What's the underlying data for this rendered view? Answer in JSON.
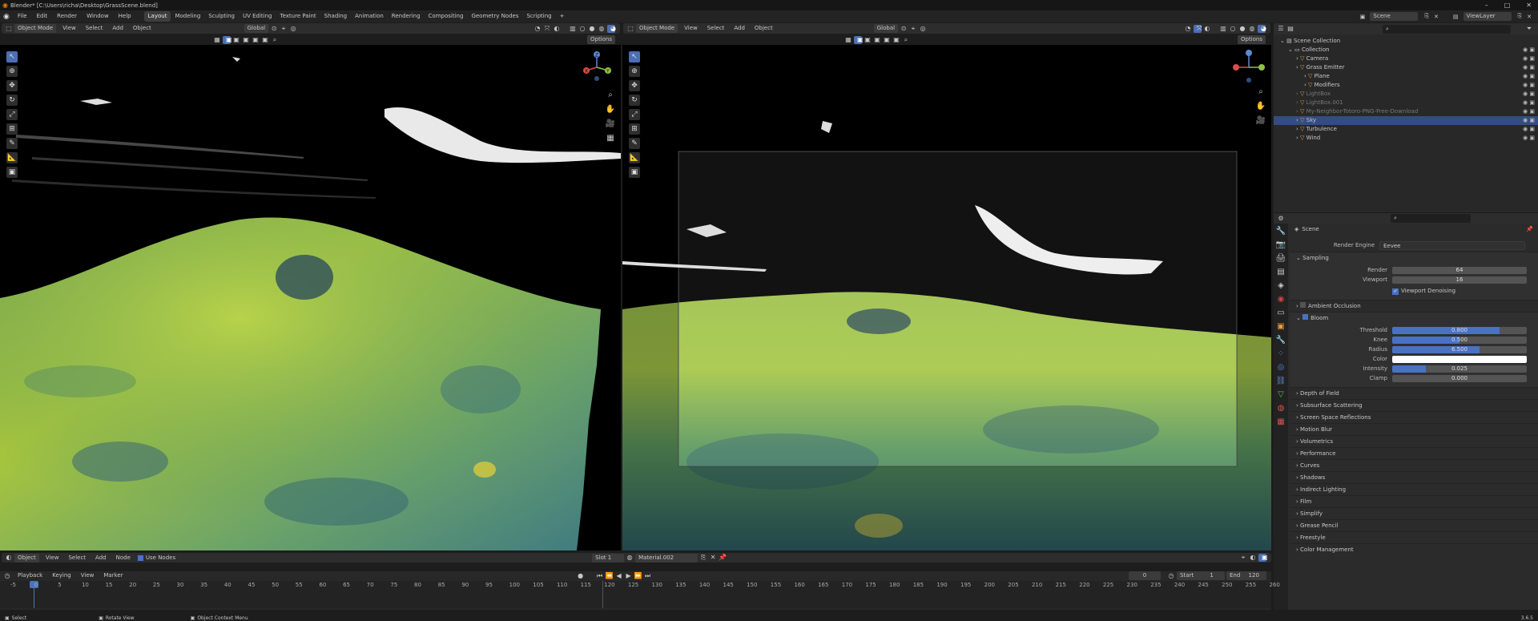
{
  "window": {
    "title": "Blender* [C:\\Users\\richa\\Desktop\\GrassScene.blend]"
  },
  "menu": [
    "File",
    "Edit",
    "Render",
    "Window",
    "Help"
  ],
  "workspaces": [
    {
      "label": "Layout",
      "active": true
    },
    {
      "label": "Modeling"
    },
    {
      "label": "Sculpting"
    },
    {
      "label": "UV Editing"
    },
    {
      "label": "Texture Paint"
    },
    {
      "label": "Shading"
    },
    {
      "label": "Animation"
    },
    {
      "label": "Rendering"
    },
    {
      "label": "Compositing"
    },
    {
      "label": "Geometry Nodes"
    },
    {
      "label": "Scripting"
    }
  ],
  "topright": {
    "scene": "Scene",
    "view_layer": "ViewLayer"
  },
  "viewport_left": {
    "mode": "Object Mode",
    "menus": [
      "View",
      "Select",
      "Add",
      "Object"
    ],
    "orientation": "Global",
    "options": "Options"
  },
  "viewport_right": {
    "mode": "Object Mode",
    "menus": [
      "View",
      "Select",
      "Add",
      "Object"
    ],
    "orientation": "Global",
    "options": "Options"
  },
  "gizmo": {
    "x": "X",
    "y": "Y",
    "z": "Z"
  },
  "outliner": {
    "items": [
      {
        "label": "Scene Collection",
        "indent": 0
      },
      {
        "label": "Collection",
        "indent": 1
      },
      {
        "label": "Camera",
        "indent": 2
      },
      {
        "label": "Grass Emitter",
        "indent": 2
      },
      {
        "label": "Plane",
        "indent": 3
      },
      {
        "label": "Modifiers",
        "indent": 3
      },
      {
        "label": "LightBox",
        "indent": 2,
        "dim": true
      },
      {
        "label": "LightBox.001",
        "indent": 2,
        "dim": true
      },
      {
        "label": "My-Neighbor-Totoro-PNG-Free-Download",
        "indent": 2,
        "dim": true
      },
      {
        "label": "Sky",
        "indent": 2,
        "selected": true
      },
      {
        "label": "Turbulence",
        "indent": 2
      },
      {
        "label": "Wind",
        "indent": 2
      }
    ]
  },
  "properties": {
    "scene_label": "Scene",
    "render_engine_label": "Render Engine",
    "render_engine": "Eevee",
    "sampling": {
      "title": "Sampling",
      "render_label": "Render",
      "render": "64",
      "viewport_label": "Viewport",
      "viewport": "16",
      "denoise": "Viewport Denoising"
    },
    "ambient_occlusion": "Ambient Occlusion",
    "bloom": {
      "title": "Bloom",
      "threshold_label": "Threshold",
      "threshold": "0.800",
      "threshold_pct": 0.8,
      "knee_label": "Knee",
      "knee": "0.500",
      "knee_pct": 0.5,
      "radius_label": "Radius",
      "radius": "6.500",
      "radius_pct": 0.65,
      "color_label": "Color",
      "intensity_label": "Intensity",
      "intensity": "0.025",
      "intensity_pct": 0.25,
      "clamp_label": "Clamp",
      "clamp": "0.000",
      "clamp_pct": 0
    }
  },
  "panel_sections": [
    "Depth of Field",
    "Subsurface Scattering",
    "Screen Space Reflections",
    "Motion Blur",
    "Volumetrics",
    "Performance",
    "Curves",
    "Shadows",
    "Indirect Lighting",
    "Film",
    "Simplify",
    "Grease Pencil",
    "Freestyle",
    "Color Management"
  ],
  "shader_editor": {
    "mode": "Object",
    "menus": [
      "View",
      "Select",
      "Add",
      "Node"
    ],
    "use_nodes": "Use Nodes",
    "slot": "Slot 1",
    "material": "Material.002"
  },
  "timeline": {
    "menus": [
      "Playback",
      "Keying",
      "View",
      "Marker"
    ],
    "current": "0",
    "start_label": "Start",
    "start": "1",
    "end_label": "End",
    "end": "120",
    "ticks": [
      "-5",
      "0",
      "5",
      "10",
      "15",
      "20",
      "25",
      "30",
      "35",
      "40",
      "45",
      "50",
      "55",
      "60",
      "65",
      "70",
      "75",
      "80",
      "85",
      "90",
      "95",
      "100",
      "105",
      "110",
      "115",
      "120",
      "125",
      "130",
      "135",
      "140",
      "145",
      "150",
      "155",
      "160",
      "165",
      "170",
      "175",
      "180",
      "185",
      "190",
      "195",
      "200",
      "205",
      "210",
      "215",
      "220",
      "225",
      "230",
      "235",
      "240",
      "245",
      "250",
      "255",
      "260"
    ]
  },
  "statusbar": {
    "select": "Select",
    "rotate": "Rotate View",
    "context": "Object Context Menu",
    "version": "3.6.5"
  }
}
